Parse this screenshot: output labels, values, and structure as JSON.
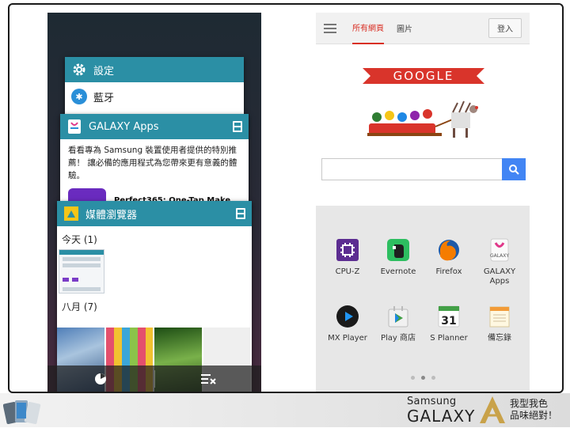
{
  "recent_apps": {
    "settings_card": {
      "title": "設定",
      "item_label": "藍牙"
    },
    "galaxy_card": {
      "title": "GALAXY Apps",
      "description": "看看專為 Samsung 裝置使用者提供的特別推薦！ 讓必備的應用程式為您帶來更有意義的體驗。",
      "app_name": "Perfect365: One-Tap Make..."
    },
    "media_card": {
      "title": "媒體瀏覽器",
      "section_today": "今天 (1)",
      "section_august": "八月 (7)"
    }
  },
  "browser": {
    "tabs": [
      "所有網頁",
      "圖片"
    ],
    "active_tab": 0,
    "signin_label": "登入",
    "doodle_text": "GOOGLE",
    "search_placeholder": ""
  },
  "launcher": {
    "apps": [
      {
        "label": "CPU-Z",
        "icon": "cpu-z-icon"
      },
      {
        "label": "Evernote",
        "icon": "evernote-icon"
      },
      {
        "label": "Firefox",
        "icon": "firefox-icon"
      },
      {
        "label": "GALAXY\nApps",
        "icon": "galaxy-apps-icon"
      },
      {
        "label": "MX Player",
        "icon": "mx-player-icon"
      },
      {
        "label": "Play 商店",
        "icon": "play-store-icon"
      },
      {
        "label": "S Planner",
        "icon": "s-planner-icon"
      },
      {
        "label": "備忘錄",
        "icon": "memo-icon"
      }
    ],
    "planner_day": "31",
    "page_count": 3,
    "active_page": 1
  },
  "footer": {
    "brand_top": "Samsung",
    "brand_main": "GALAXY",
    "slogan_line1": "我型我色",
    "slogan_line2": "品味絕對！"
  },
  "colors": {
    "card_header": "#2b8fa5",
    "active_tab": "#d93025",
    "search_button": "#4285f4"
  }
}
